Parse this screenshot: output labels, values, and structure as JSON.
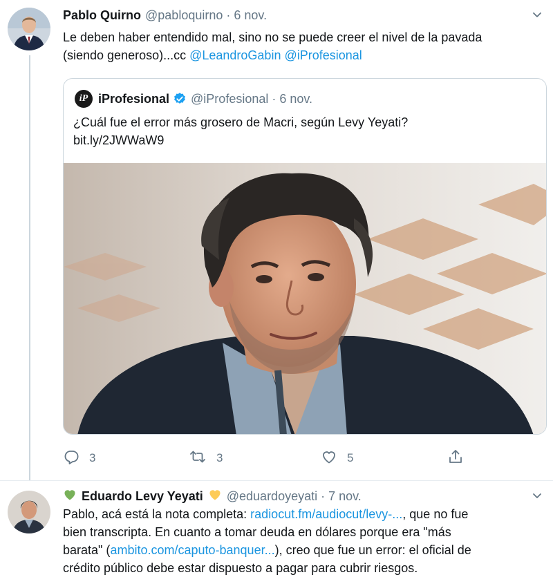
{
  "tweet1": {
    "author_name": "Pablo Quirno",
    "author_handle": "@pabloquirno",
    "separator": "·",
    "date": "6 nov.",
    "text_line1": "Le deben haber entendido mal, sino no se puede creer el nivel de la pavada",
    "text_line2_prefix": "(siendo generoso)...cc ",
    "mention1": "@LeandroGabin",
    "mention2": "@iProfesional",
    "quoted": {
      "avatar_text": "iP",
      "name": "iProfesional",
      "handle": "@iProfesional",
      "date": "6 nov.",
      "text": "¿Cuál fue el error más grosero de Macri, según Levy Yeyati?",
      "link": "bit.ly/2JWWaW9"
    },
    "actions": {
      "reply_count": "3",
      "retweet_count": "3",
      "like_count": "5"
    }
  },
  "tweet2": {
    "author_name": "Eduardo Levy Yeyati",
    "author_handle": "@eduardoyeyati",
    "separator": "·",
    "date": "7 nov.",
    "line1_a": "Pablo, acá está la nota completa: ",
    "line1_link": "radiocut.fm/audiocut/levy-...",
    "line1_b": ", que no fue",
    "line2": "bien transcripta. En cuanto a tomar deuda en dólares porque era \"más",
    "line3_a": "barata\" (",
    "line3_link": "ambito.com/caputo-banquer...",
    "line3_b": "), creo que fue un error: el oficial de",
    "line4": "crédito público debe estar dispuesto a pagar para cubrir riesgos."
  },
  "icons": {
    "reply": "reply-icon",
    "retweet": "retweet-icon",
    "like": "heart-icon",
    "share": "share-icon",
    "more": "chevron-down-icon",
    "verified": "verified-badge-icon"
  },
  "colors": {
    "link": "#1b95e0",
    "secondary": "#657786",
    "border": "#ccd6dd",
    "heart_green": "#78b159",
    "heart_yellow": "#fdcb58"
  }
}
